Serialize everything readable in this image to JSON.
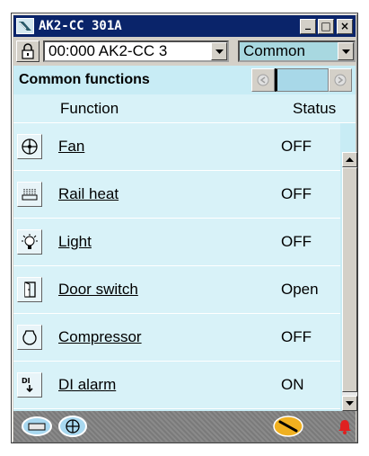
{
  "window": {
    "title": "AK2-CC 301A",
    "minimize_glyph": "_",
    "maximize_glyph": "□",
    "close_glyph": "×"
  },
  "toolbar": {
    "device_value": "00:000 AK2-CC 3",
    "view_value": "Common"
  },
  "panel": {
    "title": "Common functions",
    "columns": {
      "function": "Function",
      "status": "Status"
    },
    "rows": [
      {
        "label": "Fan",
        "status": "OFF",
        "icon": "fan-icon"
      },
      {
        "label": "Rail heat",
        "status": "OFF",
        "icon": "rail-heat-icon"
      },
      {
        "label": "Light",
        "status": "OFF",
        "icon": "light-bulb-icon"
      },
      {
        "label": "Door switch",
        "status": "Open",
        "icon": "door-icon"
      },
      {
        "label": "Compressor",
        "status": "OFF",
        "icon": "compressor-icon"
      },
      {
        "label": "DI alarm",
        "status": "ON",
        "icon": "di-alarm-icon"
      }
    ]
  },
  "bottombar": {
    "items": [
      "device-list-icon",
      "fan-nav-icon",
      "service-tool-icon",
      "alarm-bell-icon"
    ]
  },
  "colors": {
    "titlebar": "#0a246a",
    "panel_bg": "#c8ecf5",
    "row_bg": "#d8f2f8",
    "alarm": "#e02020"
  }
}
